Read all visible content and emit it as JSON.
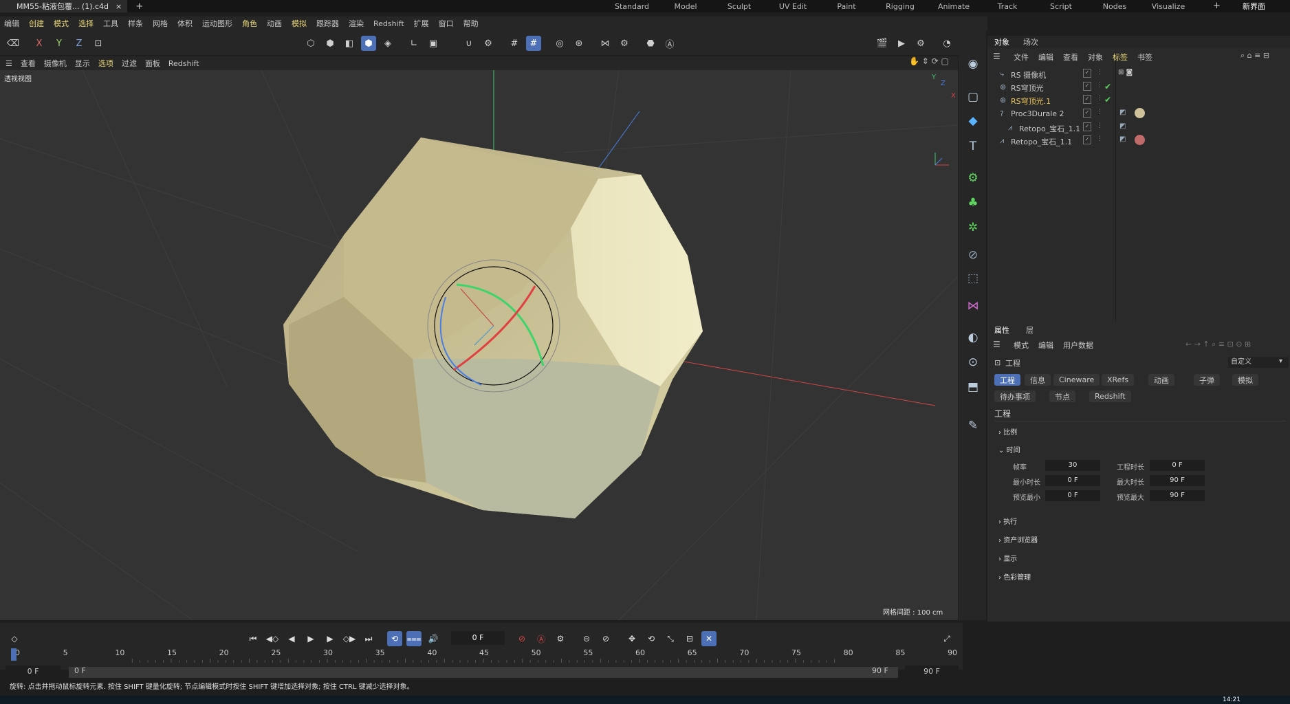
{
  "window": {
    "doc_title": "MM55-粘液包覆... (1).c4d",
    "close": "×",
    "new_tab": "+"
  },
  "layouts": [
    "Standard",
    "Model",
    "Sculpt",
    "UV Edit",
    "Paint",
    "Rigging",
    "Animate",
    "Track",
    "Script",
    "Nodes",
    "Visualize"
  ],
  "layout_add": "+",
  "new_ui": "新界面",
  "menu": [
    "编辑",
    "创建",
    "模式",
    "选择",
    "工具",
    "样条",
    "网格",
    "体积",
    "运动图形",
    "角色",
    "动画",
    "模拟",
    "跟踪器",
    "渲染",
    "Redshift",
    "扩展",
    "窗口",
    "帮助"
  ],
  "axis_toggles": {
    "x": "X",
    "y": "Y",
    "z": "Z"
  },
  "viewport_menu": [
    "查看",
    "摄像机",
    "显示",
    "选项",
    "过滤",
    "面板",
    "Redshift"
  ],
  "viewport": {
    "label": "透视视图",
    "grid_spacing": "网格间距 : 100 cm",
    "axes": {
      "x": "X",
      "y": "Y",
      "z": "Z"
    }
  },
  "object_manager": {
    "tabs": [
      "对象",
      "场次"
    ],
    "menu": [
      "文件",
      "编辑",
      "查看",
      "对象",
      "标签",
      "书签"
    ],
    "objects": [
      {
        "name": "RS 摄像机",
        "color": "#c8c8c8",
        "check": ""
      },
      {
        "name": "RS穹顶光",
        "color": "#c8c8c8",
        "check": "✔"
      },
      {
        "name": "RS穹顶光.1",
        "color": "#e8c45a",
        "check": "✔"
      },
      {
        "name": "Proc3Durale 2",
        "color": "#c8c8c8",
        "check": ""
      },
      {
        "name": "Retopo_宝石_1.1",
        "color": "#c8c8c8",
        "check": ""
      },
      {
        "name": "Retopo_宝石_1.1",
        "color": "#c8c8c8",
        "check": ""
      }
    ]
  },
  "attributes": {
    "tabs": [
      "属性",
      "层"
    ],
    "menu": [
      "模式",
      "编辑",
      "用户数据"
    ],
    "header": "工程",
    "preset": "自定义",
    "chips_row1": [
      "工程",
      "信息",
      "Cineware",
      "XRefs",
      "动画",
      "子弹",
      "模拟"
    ],
    "chips_row2": [
      "待办事项",
      "节点",
      "Redshift"
    ],
    "section": "工程",
    "groups": {
      "scale": "比例",
      "time": "时间",
      "exec": "执行",
      "asset": "资产浏览器",
      "display": "显示",
      "color": "色彩管理"
    },
    "fields": {
      "fps_label": "帧率",
      "fps": "30",
      "duration_label": "工程时长",
      "duration": "0 F",
      "min_label": "最小时长",
      "min": "0 F",
      "max_label": "最大时长",
      "max": "90 F",
      "pmin_label": "预览最小",
      "pmin": "0 F",
      "pmax_label": "预览最大",
      "pmax": "90 F"
    }
  },
  "timeline": {
    "current_frame": "0 F",
    "ticks": [
      "0",
      "5",
      "10",
      "15",
      "20",
      "25",
      "30",
      "35",
      "40",
      "45",
      "50",
      "55",
      "60",
      "65",
      "70",
      "75",
      "80",
      "85",
      "90"
    ],
    "range_start": "0 F",
    "range_inner_start": "0 F",
    "range_inner_end": "90 F",
    "range_end": "90 F"
  },
  "status": "旋转: 点击并拖动鼠标旋转元素. 按住 SHIFT 键量化旋转; 节点编辑模式时按住 SHIFT 键增加选择对象; 按住 CTRL 键减少选择对象。",
  "clock": "14:21"
}
